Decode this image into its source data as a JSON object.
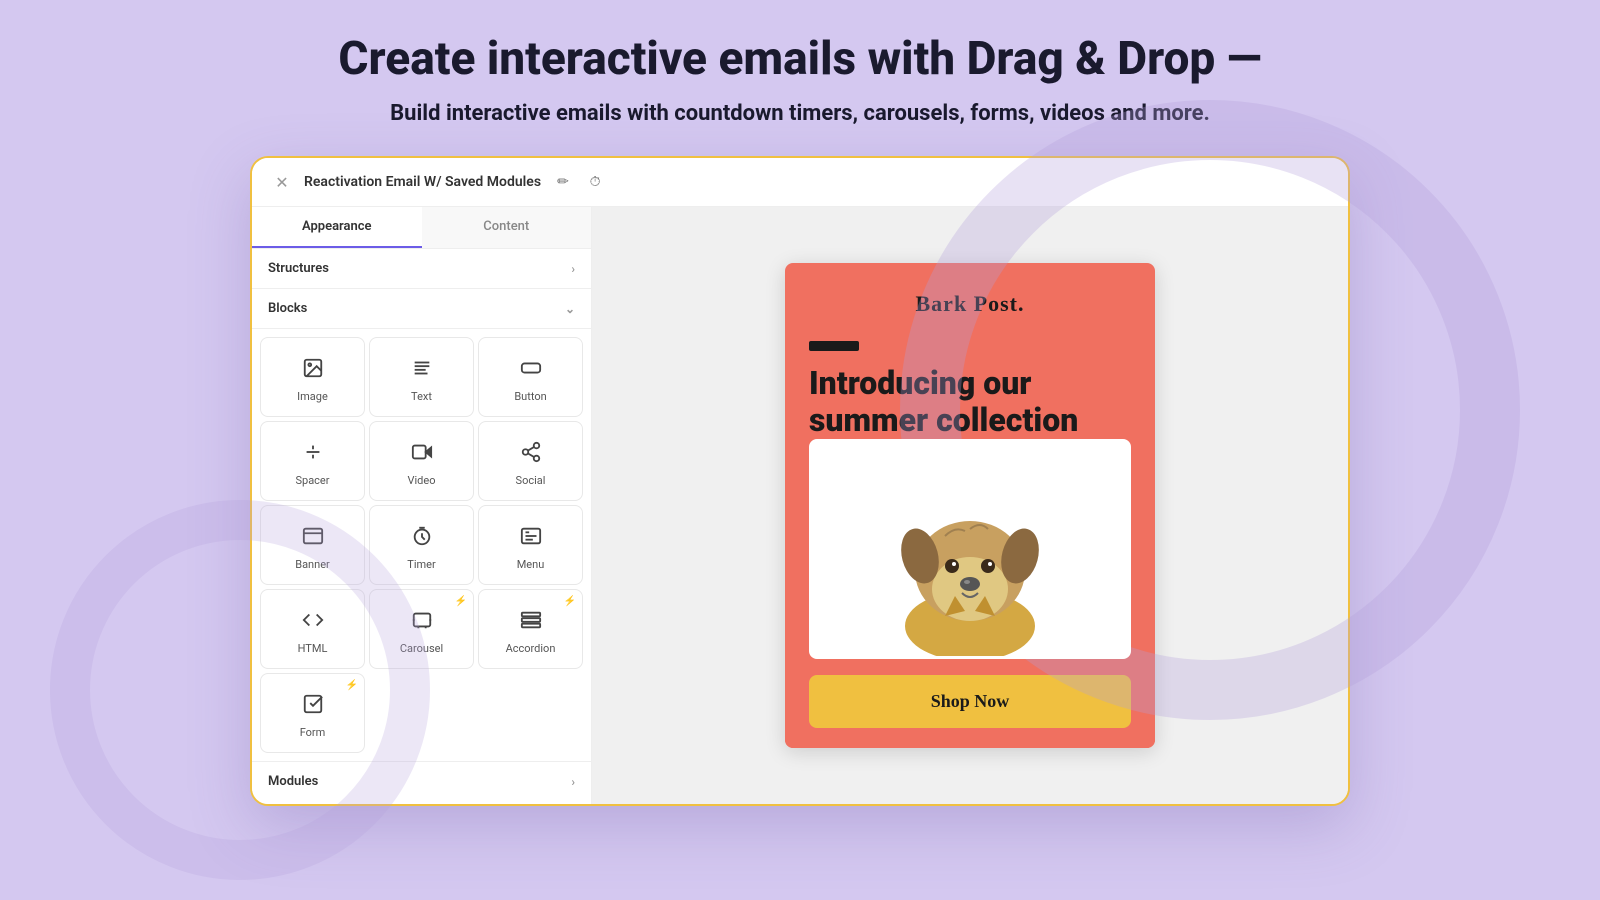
{
  "page": {
    "headline": "Create interactive emails with Drag & Drop —",
    "subheadline": "Build interactive emails with countdown timers, carousels, forms, videos and more."
  },
  "window": {
    "title": "Reactivation Email W/ Saved Modules",
    "close_label": "×"
  },
  "tabs": [
    {
      "id": "appearance",
      "label": "Appearance",
      "active": true
    },
    {
      "id": "content",
      "label": "Content",
      "active": false
    }
  ],
  "sections": {
    "structures": "Structures",
    "blocks": "Blocks",
    "modules": "Modules"
  },
  "blocks": [
    {
      "id": "image",
      "label": "Image",
      "icon": "image",
      "has_lightning": false
    },
    {
      "id": "text",
      "label": "Text",
      "icon": "text",
      "has_lightning": false
    },
    {
      "id": "button",
      "label": "Button",
      "icon": "button",
      "has_lightning": false
    },
    {
      "id": "spacer",
      "label": "Spacer",
      "icon": "spacer",
      "has_lightning": false
    },
    {
      "id": "video",
      "label": "Video",
      "icon": "video",
      "has_lightning": false
    },
    {
      "id": "social",
      "label": "Social",
      "icon": "social",
      "has_lightning": false
    },
    {
      "id": "banner",
      "label": "Banner",
      "icon": "banner",
      "has_lightning": false
    },
    {
      "id": "timer",
      "label": "Timer",
      "icon": "timer",
      "has_lightning": false
    },
    {
      "id": "menu",
      "label": "Menu",
      "icon": "menu",
      "has_lightning": false
    },
    {
      "id": "html",
      "label": "HTML",
      "icon": "html",
      "has_lightning": false
    },
    {
      "id": "carousel",
      "label": "Carousel",
      "icon": "carousel",
      "has_lightning": true
    },
    {
      "id": "accordion",
      "label": "Accordion",
      "icon": "accordion",
      "has_lightning": true
    },
    {
      "id": "form",
      "label": "Form",
      "icon": "form",
      "has_lightning": true
    }
  ],
  "email_preview": {
    "brand": "Bark Post.",
    "title": "Introducing our summer collection",
    "cta": "Shop Now",
    "accent_color": "#f07060",
    "cta_color": "#f0c040"
  },
  "icons": {
    "image": "🖼",
    "text": "≡",
    "button": "▭",
    "spacer": "÷",
    "video": "▶",
    "social": "⋈",
    "banner": "▤",
    "timer": "◷",
    "menu": "⊞",
    "html": "<>",
    "carousel": "⊡",
    "accordion": "≣",
    "form": "☑"
  }
}
